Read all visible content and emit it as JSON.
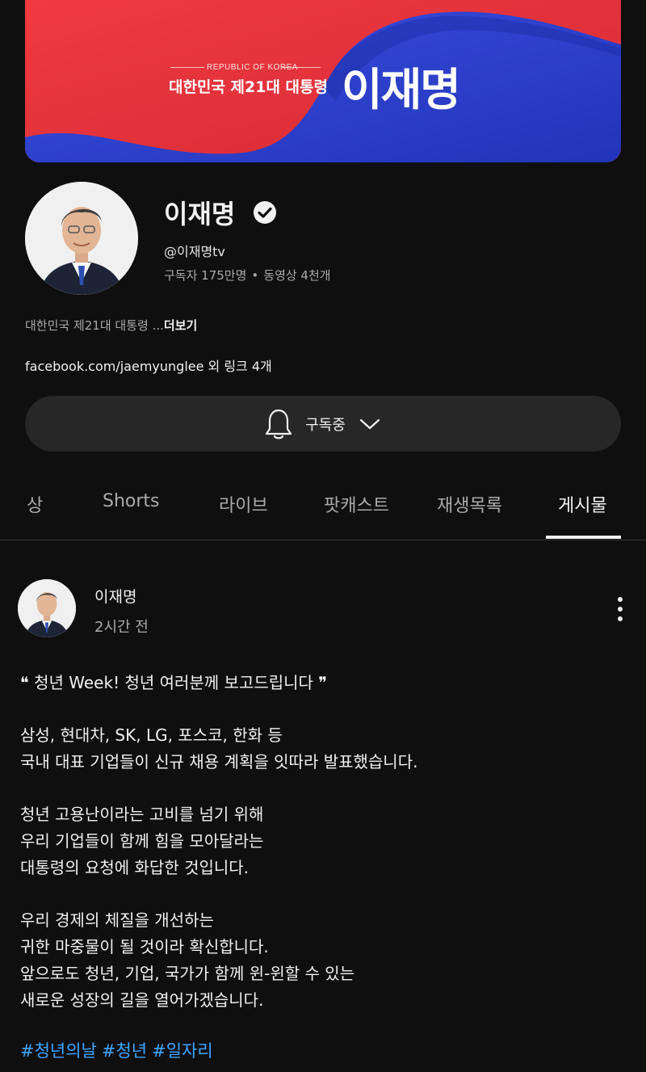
{
  "banner": {
    "subtitle": "REPUBLIC OF KOREA",
    "office": "대한민국 제21대 대통령",
    "name": "이재명"
  },
  "channel": {
    "name": "이재명",
    "handle": "@이재명tv",
    "subscribers": "구독자 175만명",
    "videos": "동영상 4천개",
    "description": "대한민국 제21대 대통령 ...",
    "more_label": "더보기",
    "links": "facebook.com/jaemyunglee 외 링크 4개",
    "verified_icon": "check-circle-icon"
  },
  "subscribe": {
    "label": "구독중",
    "bell_icon": "bell-icon",
    "chevron_icon": "chevron-down-icon"
  },
  "tabs": [
    {
      "label": "상"
    },
    {
      "label": "Shorts"
    },
    {
      "label": "라이브"
    },
    {
      "label": "팟캐스트"
    },
    {
      "label": "재생목록"
    },
    {
      "label": "게시물",
      "active": true
    }
  ],
  "post": {
    "author": "이재명",
    "time": "2시간 전",
    "lines": [
      "❝ 청년 Week! 청년 여러분께 보고드립니다 ❞",
      "",
      "삼성, 현대차, SK, LG, 포스코, 한화 등",
      "국내 대표 기업들이 신규 채용 계획을 잇따라 발표했습니다.",
      "",
      "청년 고용난이라는 고비를 넘기 위해",
      "우리 기업들이 함께 힘을 모아달라는",
      "대통령의 요청에 화답한 것입니다.",
      "",
      "우리 경제의 체질을 개선하는",
      "귀한 마중물이 될 것이라 확신합니다.",
      "앞으로도 청년, 기업, 국가가 함께 윈-윈할 수 있는",
      "새로운 성장의 길을 열어가겠습니다."
    ],
    "hashtags": [
      "#청년의날",
      "#청년",
      "#일자리"
    ]
  },
  "colors": {
    "background": "#0f0f0f",
    "banner_red": "#e8323c",
    "banner_blue": "#2b3fd1",
    "hashtag": "#3ea6ff"
  }
}
